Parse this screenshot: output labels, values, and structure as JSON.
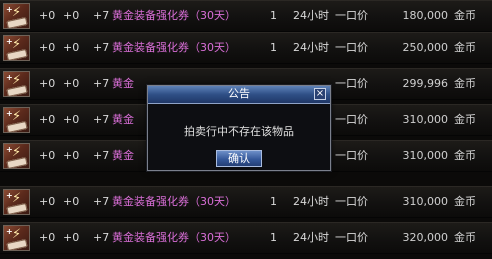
{
  "rows": [
    {
      "plus1": "+0",
      "plus2": "+0",
      "enhance": "+7",
      "name": "黄金装备强化券（30天）",
      "qty": "1",
      "duration": "24小时",
      "mode": "一口价",
      "price": "180,000",
      "currency": "金币"
    },
    {
      "plus1": "+0",
      "plus2": "+0",
      "enhance": "+7",
      "name": "黄金装备强化券（30天）",
      "qty": "1",
      "duration": "24小时",
      "mode": "一口价",
      "price": "250,000",
      "currency": "金币"
    },
    {
      "plus1": "+0",
      "plus2": "+0",
      "enhance": "+7",
      "name": "黄金",
      "qty": "",
      "duration": "",
      "mode": "一口价",
      "price": "299,996",
      "currency": "金币"
    },
    {
      "plus1": "+0",
      "plus2": "+0",
      "enhance": "+7",
      "name": "黄金",
      "qty": "",
      "duration": "",
      "mode": "一口价",
      "price": "310,000",
      "currency": "金币"
    },
    {
      "plus1": "+0",
      "plus2": "+0",
      "enhance": "+7",
      "name": "黄金",
      "qty": "",
      "duration": "",
      "mode": "一口价",
      "price": "310,000",
      "currency": "金币"
    },
    {
      "plus1": "+0",
      "plus2": "+0",
      "enhance": "+7",
      "name": "黄金装备强化券（30天）",
      "qty": "1",
      "duration": "24小时",
      "mode": "一口价",
      "price": "310,000",
      "currency": "金币"
    },
    {
      "plus1": "+0",
      "plus2": "+0",
      "enhance": "+7",
      "name": "黄金装备强化券（30天）",
      "qty": "1",
      "duration": "24小时",
      "mode": "一口价",
      "price": "320,000",
      "currency": "金币"
    }
  ],
  "dialog": {
    "title": "公告",
    "close": "×",
    "message": "拍卖行中不存在该物品",
    "ok": "确认"
  },
  "colors": {
    "item_name": "#d86ed6",
    "row_text": "#d9d9d9",
    "dialog_title": "#2f4f86"
  },
  "icons": {
    "item": "ticket-icon",
    "close": "close-icon"
  }
}
